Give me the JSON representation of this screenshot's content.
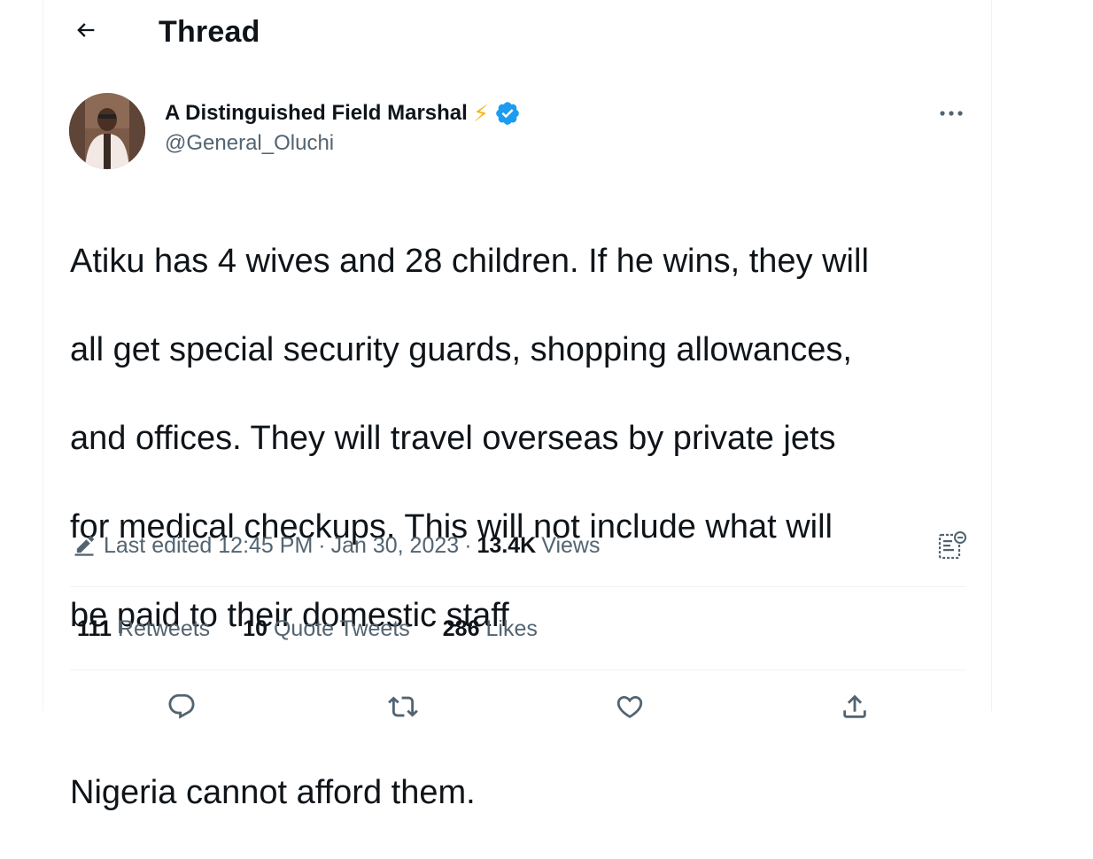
{
  "header": {
    "title": "Thread"
  },
  "author": {
    "name": "A Distinguished Field Marshal",
    "emoji": "⚡",
    "handle": "@General_Oluchi"
  },
  "tweet": {
    "text_lines": [
      "Atiku has 4 wives and 28 children. If he wins, they will",
      "all get special security guards, shopping allowances,",
      "and offices. They will travel overseas by private jets",
      "for medical checkups. This will not include what will",
      "be paid to their domestic staff",
      "",
      "Nigeria cannot afford them."
    ],
    "edited_label": "Last edited 12:45 PM",
    "date": "Jan 30, 2023",
    "views_count": "13.4K",
    "views_label": "Views"
  },
  "stats": {
    "retweets_count": "111",
    "retweets_label": "Retweets",
    "quotes_count": "10",
    "quotes_label": "Quote Tweets",
    "likes_count": "286",
    "likes_label": "Likes"
  },
  "colors": {
    "text_primary": "#0f1419",
    "text_secondary": "#536471",
    "verified": "#1d9bf0",
    "divider": "#eff3f4"
  },
  "icons": {
    "back": "arrow-left-icon",
    "verified": "verified-badge-icon",
    "more": "more-horizontal-icon",
    "edit": "pencil-icon",
    "analytics": "analytics-icon",
    "reply": "reply-icon",
    "retweet": "retweet-icon",
    "like": "heart-icon",
    "share": "share-icon"
  }
}
